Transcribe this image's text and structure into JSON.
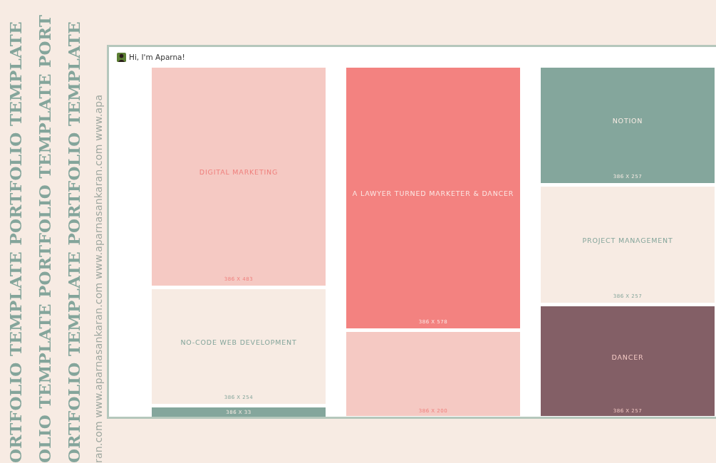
{
  "side_banner": {
    "columns": [
      "ORTFOLIO TEMPLATE PORTFOLIO TEMPLATE",
      "OLIO TEMPLATE PORTFOLIO TEMPLATE PORT",
      "ORTFOLIO TEMPLATE PORTFOLIO TEMPLATE"
    ],
    "website": "ran.com www.aparnasankaran.com www.aparnasankaran.com www.apa"
  },
  "window": {
    "greeting": "Hi, I'm Aparna!",
    "columns": [
      [
        {
          "kind": "blush",
          "title": "DIGITAL MARKETING",
          "size": "386 X 483"
        },
        {
          "kind": "cream",
          "title": "NO-CODE WEB DEVELOPMENT",
          "size": "386 X 254"
        },
        {
          "kind": "sage",
          "size": "386 X 33"
        }
      ],
      [
        {
          "kind": "coral",
          "title": "A LAWYER TURNED MARKETER & DANCER",
          "size": "386 X 578"
        },
        {
          "kind": "blush",
          "size": "386 X 200"
        }
      ],
      [
        {
          "kind": "sage",
          "title": "NOTION",
          "size": "386 X 257"
        },
        {
          "kind": "cream",
          "title": "PROJECT MANAGEMENT",
          "size": "386 X 257"
        },
        {
          "kind": "plum",
          "title": "DANCER",
          "size": "386 X 257"
        }
      ]
    ]
  }
}
